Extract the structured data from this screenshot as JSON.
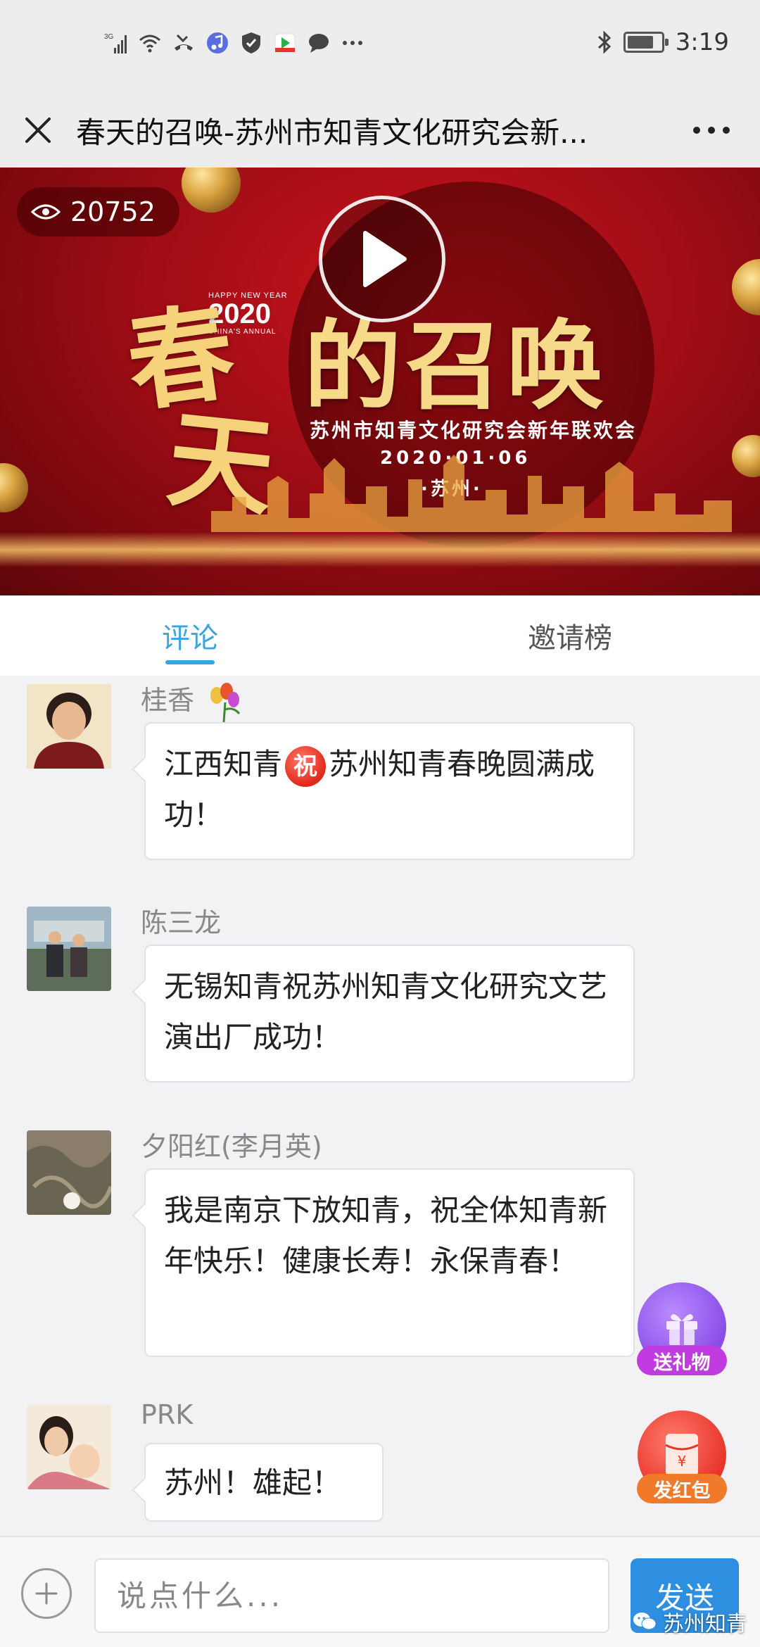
{
  "status_bar": {
    "network": "3G",
    "time": "3:19",
    "icons": [
      "signal-icon",
      "wifi-icon",
      "missed-call-icon",
      "music-icon",
      "shield-icon",
      "video-app-icon",
      "chat-icon",
      "more-dots-icon",
      "bluetooth-icon",
      "battery-icon"
    ]
  },
  "header": {
    "title": "春天的召唤-苏州市知青文化研究会新..."
  },
  "banner": {
    "views": "20752",
    "happy_new_year": "HAPPY NEW YEAR",
    "year": "2020",
    "chinas_annual": "CHINA'S ANNUAL",
    "title_chars": [
      "春",
      "天",
      "的召唤"
    ],
    "subtitle": "苏州市知青文化研究会新年联欢会",
    "date": "2020·01·06",
    "city": "·苏州·"
  },
  "tabs": [
    {
      "label": "评论",
      "active": true
    },
    {
      "label": "邀请榜",
      "active": false
    }
  ],
  "comments": [
    {
      "name": "桂香",
      "text_before": "江西知青",
      "badge": "祝",
      "text_after": "苏州知青春晚圆满成功！"
    },
    {
      "name": "陈三龙",
      "text": "无锡知青祝苏州知青文化研究文艺演出厂成功！"
    },
    {
      "name": "夕阳红(李月英)",
      "text": "我是南京下放知青，祝全体知青新年快乐！健康长寿！永保青春！"
    },
    {
      "name": "PRK",
      "text": "苏州！雄起！"
    }
  ],
  "fab": {
    "gift_label": "送礼物",
    "redpacket_label": "发红包",
    "redpacket_symbol": "¥"
  },
  "input": {
    "placeholder": "说点什么...",
    "send_label": "发送"
  },
  "watermark": "苏州知青",
  "colors": {
    "accent": "#3aa5dc",
    "send": "#2e8fe0",
    "banner_red": "#a10d15",
    "gold": "#f6d27a"
  }
}
